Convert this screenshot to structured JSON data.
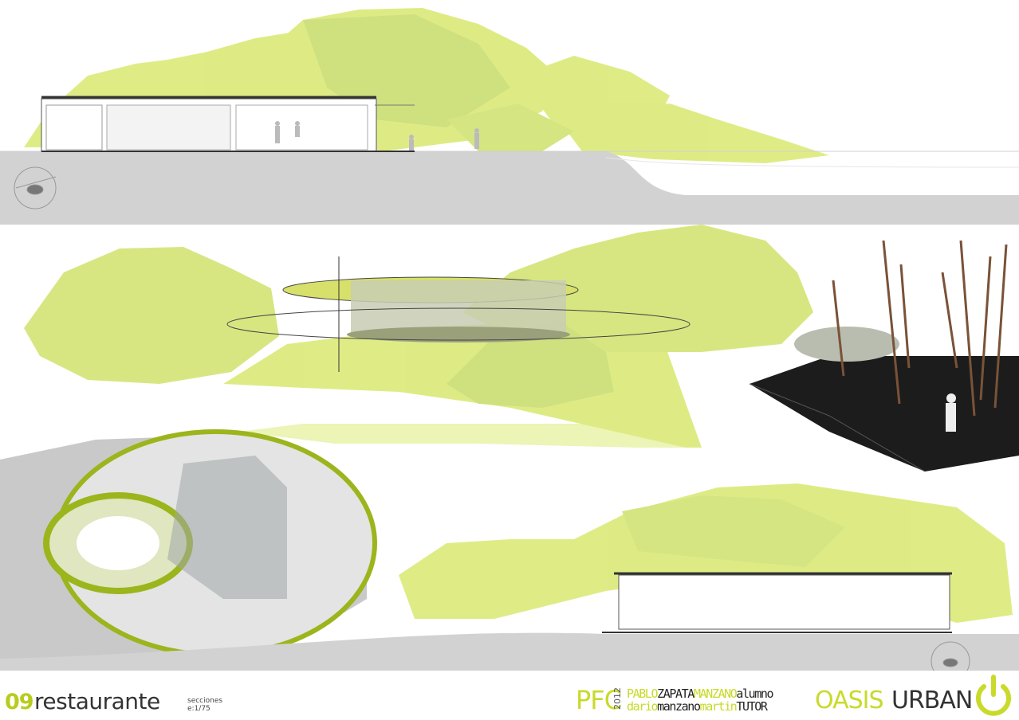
{
  "footer": {
    "sheet_number": "09",
    "sheet_title": "restaurante",
    "subtitle_line1": "secciones",
    "subtitle_line2": "e:1/75",
    "pfc": "PFC",
    "year": "2012",
    "student_first": "PABLO",
    "student_last1": "ZAPATA",
    "student_last2": "MANZANO",
    "student_role": "alumno",
    "tutor_first": "dario",
    "tutor_last1": "manzano",
    "tutor_last2": "martin",
    "tutor_role": "TUTOR",
    "project_word1": "OASIS",
    "project_word2": "URBAN",
    "logo_icon": "power-icon"
  },
  "colors": {
    "accent_green": "#c9da2a",
    "tree_green": "#c4dc22",
    "ground_grey": "#d2d2d2",
    "text_dark": "#333333"
  }
}
